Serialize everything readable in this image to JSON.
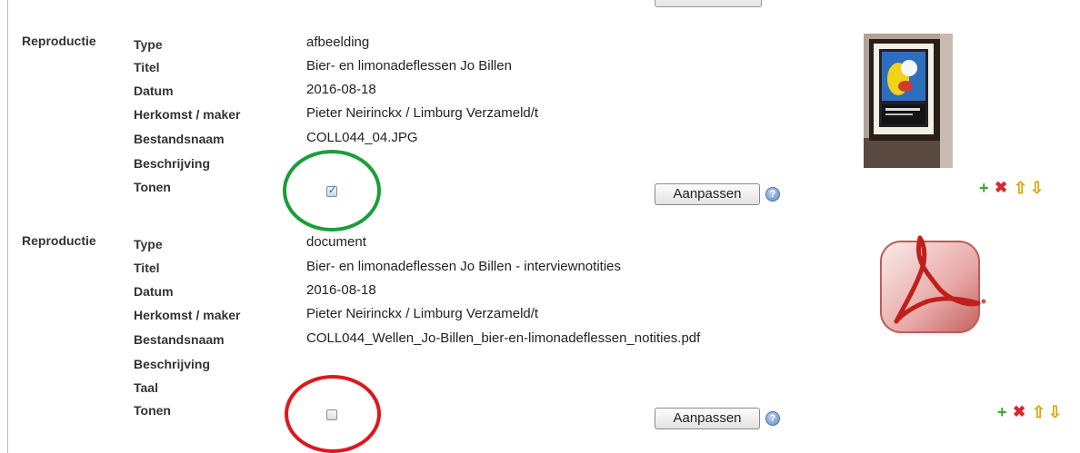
{
  "reproductions": [
    {
      "section_label": "Reproductie",
      "fields": [
        {
          "label": "Type",
          "value": "afbeelding"
        },
        {
          "label": "Titel",
          "value": "Bier- en limonadeflessen Jo Billen"
        },
        {
          "label": "Datum",
          "value": "2016-08-18"
        },
        {
          "label": "Herkomst / maker",
          "value": "Pieter Neirinckx / Limburg Verzameld/t"
        },
        {
          "label": "Bestandsnaam",
          "value": "COLL044_04.JPG"
        },
        {
          "label": "Beschrijving",
          "value": ""
        },
        {
          "label": "Tonen",
          "value": ""
        }
      ],
      "show_checked": true,
      "edit_label": "Aanpassen",
      "thumbnail": "framed-poster-photo",
      "annotation_color": "#1a9e3a"
    },
    {
      "section_label": "Reproductie",
      "fields": [
        {
          "label": "Type",
          "value": "document"
        },
        {
          "label": "Titel",
          "value": "Bier- en limonadeflessen Jo Billen - interviewnotities"
        },
        {
          "label": "Datum",
          "value": "2016-08-18"
        },
        {
          "label": "Herkomst / maker",
          "value": "Pieter Neirinckx / Limburg Verzameld/t"
        },
        {
          "label": "Bestandsnaam",
          "value": "COLL044_Wellen_Jo-Billen_bier-en-limonadeflessen_notities.pdf"
        },
        {
          "label": "Beschrijving",
          "value": ""
        },
        {
          "label": "Taal",
          "value": ""
        },
        {
          "label": "Tonen",
          "value": ""
        }
      ],
      "show_checked": false,
      "edit_label": "Aanpassen",
      "thumbnail": "pdf-icon",
      "annotation_color": "#e0161c"
    }
  ],
  "icons": {
    "help": "?",
    "check": "✓",
    "add": "+",
    "delete": "✖",
    "move_up": "⇧",
    "move_down": "⇩"
  },
  "colors": {
    "add": "#3ea52e",
    "delete": "#d9262d",
    "arrows": "#d9a300"
  }
}
